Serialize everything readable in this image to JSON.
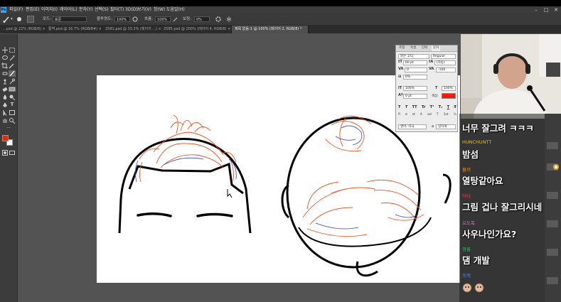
{
  "menubar": {
    "app_icon": "Ps",
    "items": [
      "파일(F)",
      "편집(E)",
      "이미지(I)",
      "레이어(L)",
      "문자(Y)",
      "선택(S)",
      "필터(T)",
      "3D(D)",
      "보기(V)",
      "창(W)",
      "도움말(H)"
    ],
    "window_controls": [
      "–",
      "□",
      "✕"
    ]
  },
  "options": {
    "mode_label": "모드:",
    "mode_value": "표준",
    "opacity_label": "불투명도:",
    "opacity_value": "100%",
    "flow_label": "흐름:",
    "flow_value": "100%",
    "smoothing_label": "보정:",
    "smoothing_value": "0%"
  },
  "tabs": [
    {
      "label": "...psd @ 22% (RGB/8) ×",
      "active": false
    },
    {
      "label": "통역.psd @ 16.7% (RGB/8#) ×",
      "active": false
    },
    {
      "label": "2581.psd @ 33.3% (레이어 ...) ×",
      "active": false
    },
    {
      "label": "2585.psd @ 200% (레이어 4, RGB/8) ×",
      "active": false
    },
    {
      "label": "제목 없음-1 @ 100% (레이어 2, RGB/8) *",
      "active": true
    }
  ],
  "properties_panel": {
    "tabs": [
      "조정",
      "속성",
      "단락",
      "문자"
    ],
    "font_family": "맑은 고딕",
    "font_style": "Regular",
    "font_size": "60 pt",
    "leading": "(자동)",
    "kerning": "0",
    "tracking": "-100",
    "scale_pct": "0%",
    "vscale": "100%",
    "hscale": "100%",
    "baseline": "0 pt",
    "color_label": "색상:",
    "style_buttons": [
      "T",
      "T",
      "TT",
      "Tr",
      "T¹",
      "T₁",
      "T",
      "T̶"
    ],
    "opentype_buttons": [
      "fi",
      "ơ",
      "st",
      "A",
      "ad",
      "T",
      "1st",
      "½"
    ],
    "language": "영어: 미국",
    "antialias_prefix": "a",
    "antialias": "강하게",
    "accent_color": "#ee1c0a"
  },
  "toolbar_icons": [
    "move-icon",
    "marquee-icon",
    "lasso-icon",
    "magic-wand-icon",
    "crop-icon",
    "eyedropper-icon",
    "healing-icon",
    "brush-icon",
    "stamp-icon",
    "history-brush-icon",
    "eraser-icon",
    "gradient-icon",
    "blur-icon",
    "dodge-icon",
    "pen-icon",
    "type-icon",
    "path-select-icon",
    "shape-icon",
    "hand-icon",
    "zoom-icon"
  ],
  "colors": {
    "foreground": "#ff2200",
    "background": "#ffffff"
  },
  "chat": {
    "messages": [
      {
        "user": "",
        "text": "너무 잘그려 ㅋㅋㅋ",
        "user_color": "#ffffff"
      },
      {
        "user": "HUNCHUNTT",
        "text": "밤섬",
        "user_color": "#e2c400"
      },
      {
        "user": "몰끼",
        "text": "열탕같아요",
        "user_color": "#ff8c00"
      },
      {
        "user": "닥터",
        "text": "그림 겁나 잘그리시네",
        "user_color": "#ff3b3b"
      },
      {
        "user": "오도독",
        "text": "사우나인가요?",
        "user_color": "#ff5ec8"
      },
      {
        "user": "영롱",
        "text": "댐 개발",
        "user_color": "#22c55e"
      },
      {
        "user": "흑백",
        "text": "",
        "user_color": "#3b82f6"
      }
    ]
  }
}
